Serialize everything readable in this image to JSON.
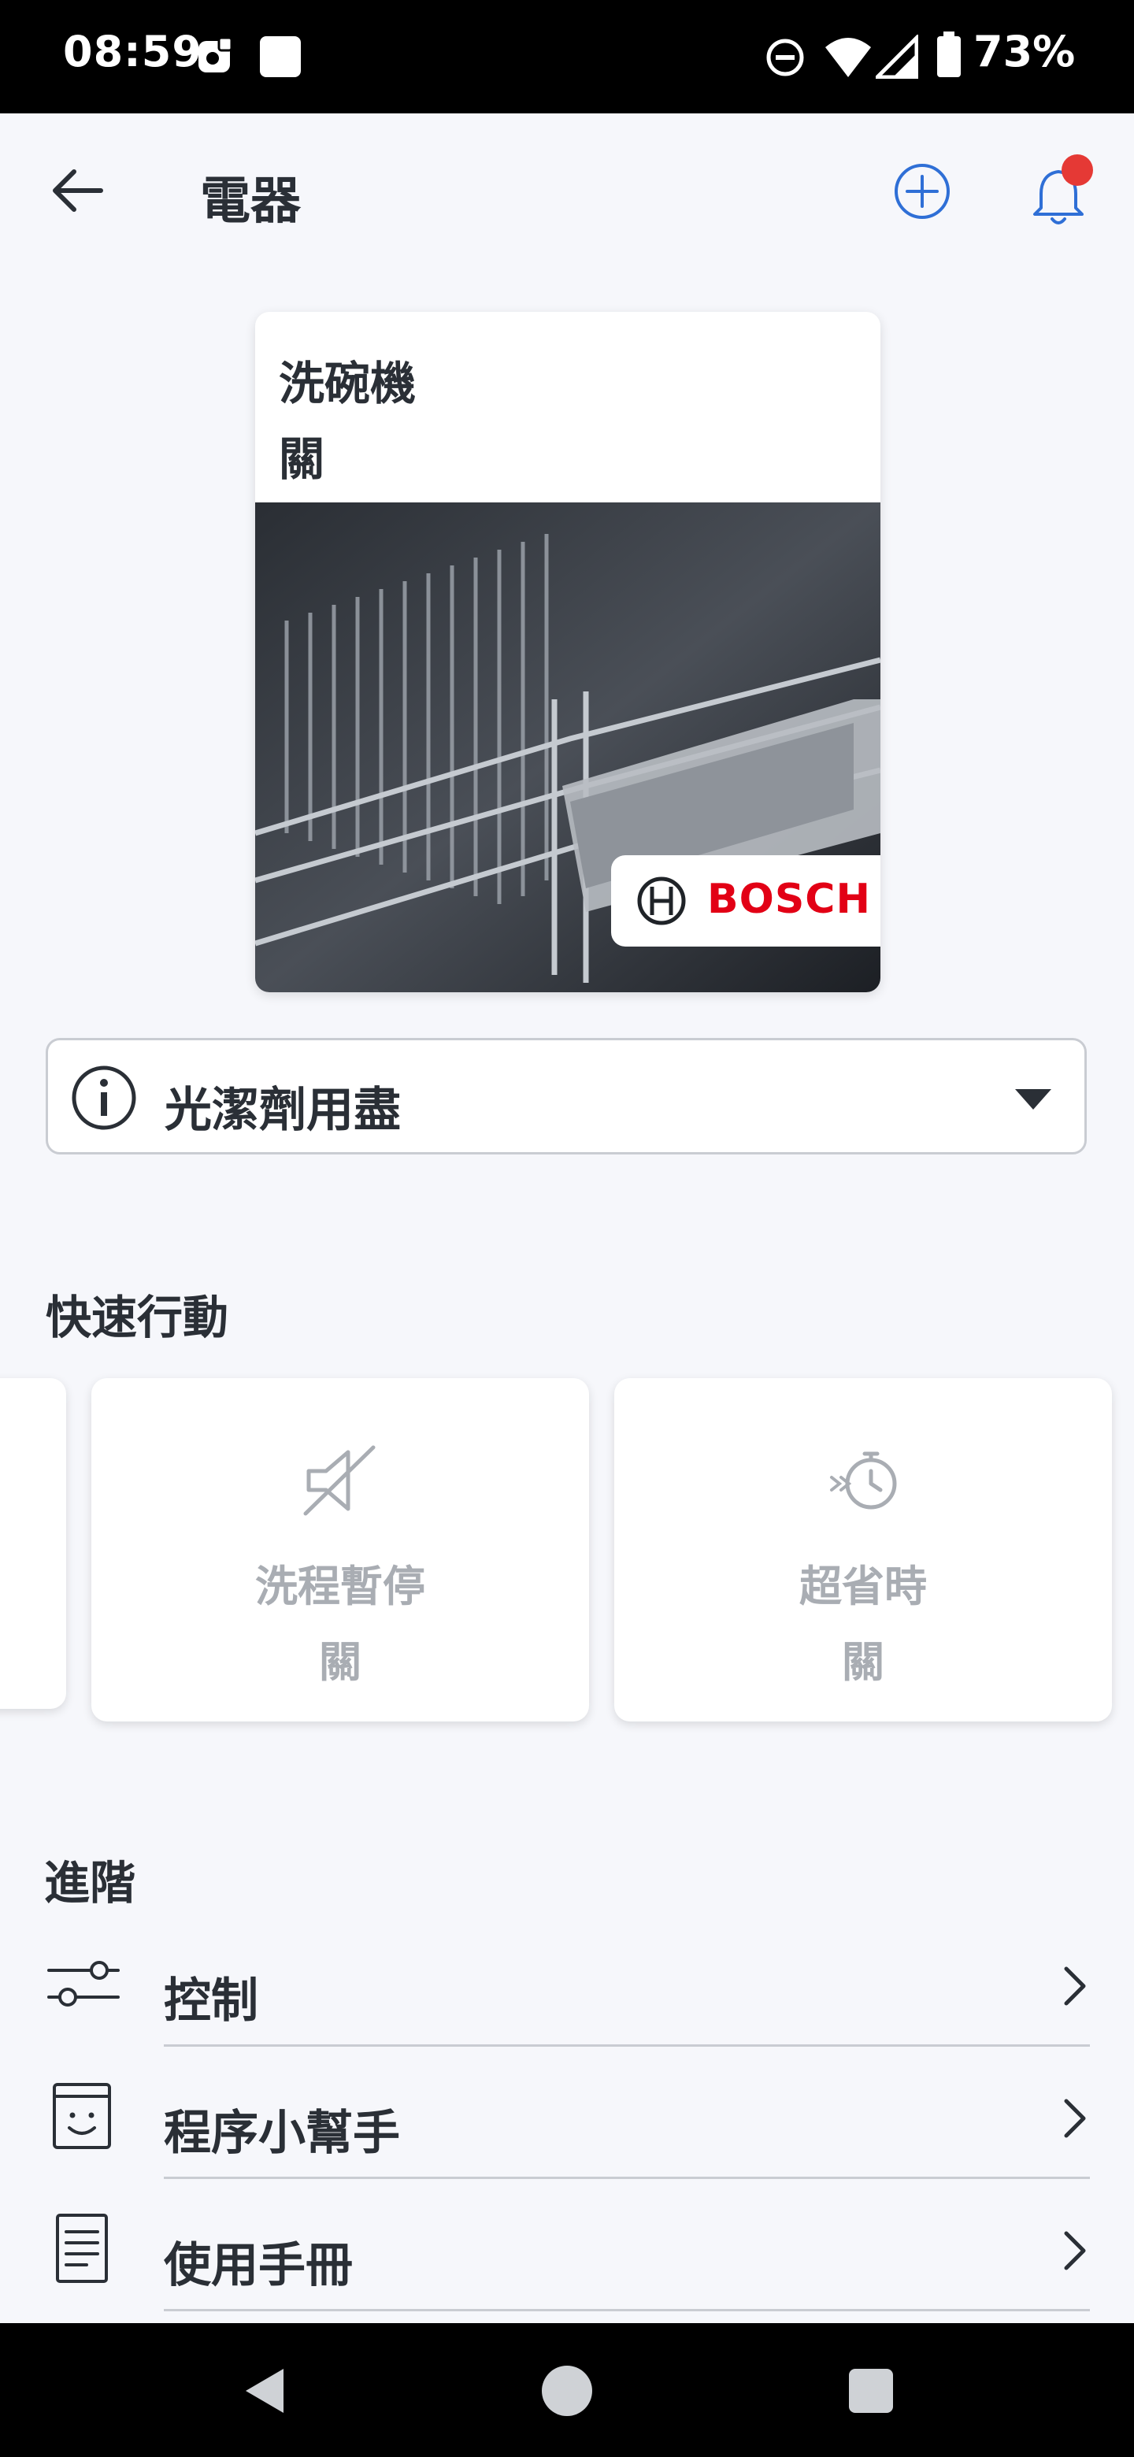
{
  "status_bar": {
    "time": "08:59",
    "battery_percent": "73%"
  },
  "app_bar": {
    "title": "電器"
  },
  "appliance": {
    "name": "洗碗機",
    "status": "關",
    "brand": "BOSCH"
  },
  "info": {
    "message": "光潔劑用盡"
  },
  "quick_actions": {
    "title": "快速行動",
    "items": [
      {
        "label": "洗程暫停",
        "status": "關",
        "icon": "mute-off-icon"
      },
      {
        "label": "超省時",
        "status": "關",
        "icon": "speed-timer-icon"
      }
    ]
  },
  "advanced": {
    "title": "進階",
    "items": [
      {
        "label": "控制",
        "icon": "sliders-icon"
      },
      {
        "label": "程序小幫手",
        "icon": "smile-calendar-icon"
      },
      {
        "label": "使用手冊",
        "icon": "document-icon"
      }
    ]
  },
  "colors": {
    "accent_blue": "#2f6fd6",
    "notification_red": "#e53935",
    "bosch_red": "#e20015"
  }
}
